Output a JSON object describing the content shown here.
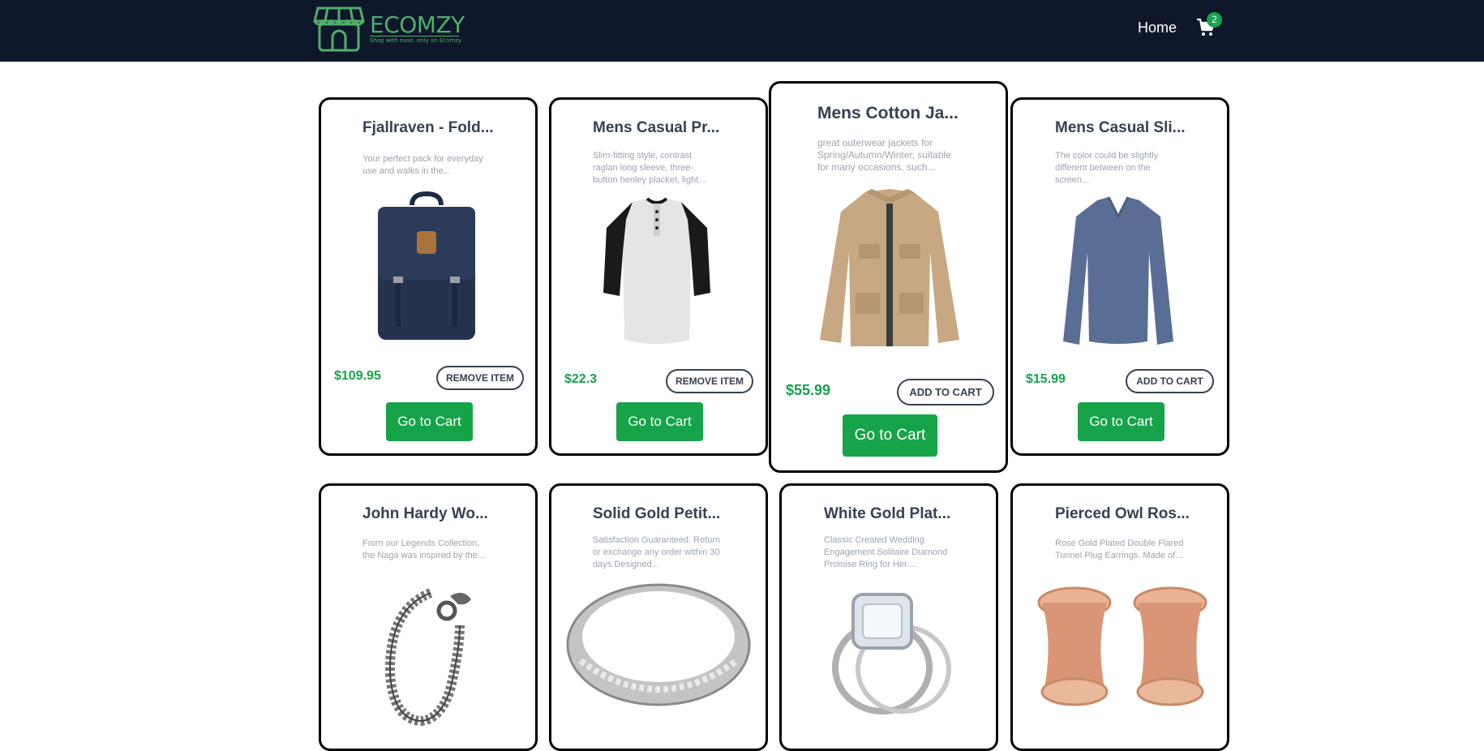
{
  "nav": {
    "logo_text": "ECOMZY",
    "logo_tagline": "Shop with ease, only on Ecomzy",
    "home_label": "Home",
    "cart_count": "2",
    "colors": {
      "bar": "#0f172a",
      "brand": "#4fae6b",
      "badge": "#16a34a"
    }
  },
  "products": [
    {
      "title": "Fjallraven - Fold...",
      "desc": "Your perfect pack for everyday use and walks in the...",
      "price": "$109.95",
      "action": "REMOVE ITEM",
      "cta": "Go to Cart",
      "image_icon": "backpack-image"
    },
    {
      "title": "Mens Casual Pr...",
      "desc": "Slim-fitting style, contrast raglan long sleeve, three-button henley placket, light...",
      "price": "$22.3",
      "action": "REMOVE ITEM",
      "cta": "Go to Cart",
      "image_icon": "henley-shirt-image"
    },
    {
      "title": "Mens Cotton Ja...",
      "desc": "great outerwear jackets for Spring/Autumn/Winter, suitable for many occasions, such...",
      "price": "$55.99",
      "action": "ADD TO CART",
      "cta": "Go to Cart",
      "image_icon": "jacket-image"
    },
    {
      "title": "Mens Casual Sli...",
      "desc": "The color could be slightly different between on the screen...",
      "price": "$15.99",
      "action": "ADD TO CART",
      "cta": "Go to Cart",
      "image_icon": "long-sleeve-tee-image"
    },
    {
      "title": "John Hardy Wo...",
      "desc": "From our Legends Collection, the Naga was inspired by the...",
      "image_icon": "bracelet-image"
    },
    {
      "title": "Solid Gold Petit...",
      "desc": "Satisfaction Guaranteed. Return or exchange any order within 30 days.Designed...",
      "image_icon": "silver-ring-image"
    },
    {
      "title": "White Gold Plat...",
      "desc": "Classic Created Wedding Engagement Solitaire Diamond Promise Ring for Her....",
      "image_icon": "diamond-ring-image"
    },
    {
      "title": "Pierced Owl Ros...",
      "desc": "Rose Gold Plated Double Flared Tunnel Plug Earrings. Made of...",
      "image_icon": "plug-earrings-image"
    }
  ]
}
